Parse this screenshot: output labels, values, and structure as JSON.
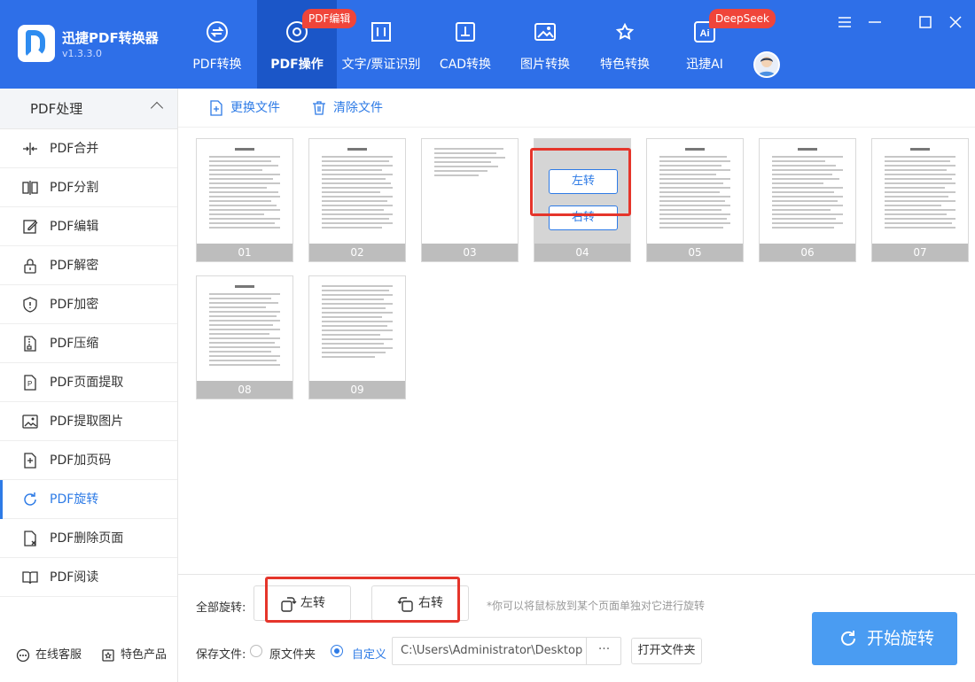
{
  "app": {
    "name": "迅捷PDF转换器",
    "version": "v1.3.3.0"
  },
  "nav": {
    "tabs": [
      {
        "label": "PDF转换",
        "icon": "pdf-convert-icon"
      },
      {
        "label": "PDF操作",
        "icon": "pdf-operate-icon",
        "active": true,
        "badge": "PDF编辑"
      },
      {
        "label": "文字/票证识别",
        "icon": "ocr-icon"
      },
      {
        "label": "CAD转换",
        "icon": "cad-icon"
      },
      {
        "label": "图片转换",
        "icon": "image-icon"
      },
      {
        "label": "特色转换",
        "icon": "star-convert-icon"
      },
      {
        "label": "迅捷AI",
        "icon": "ai-icon",
        "badge": "DeepSeek"
      }
    ]
  },
  "sidebar": {
    "section": "PDF处理",
    "items": [
      {
        "label": "PDF合并",
        "icon": "merge-icon"
      },
      {
        "label": "PDF分割",
        "icon": "split-icon"
      },
      {
        "label": "PDF编辑",
        "icon": "edit-icon"
      },
      {
        "label": "PDF解密",
        "icon": "unlock-icon"
      },
      {
        "label": "PDF加密",
        "icon": "shield-icon"
      },
      {
        "label": "PDF压缩",
        "icon": "compress-icon"
      },
      {
        "label": "PDF页面提取",
        "icon": "extract-page-icon"
      },
      {
        "label": "PDF提取图片",
        "icon": "extract-image-icon"
      },
      {
        "label": "PDF加页码",
        "icon": "page-number-icon"
      },
      {
        "label": "PDF旋转",
        "icon": "rotate-icon",
        "active": true
      },
      {
        "label": "PDF删除页面",
        "icon": "delete-page-icon"
      },
      {
        "label": "PDF阅读",
        "icon": "book-icon"
      }
    ],
    "footer": {
      "service": "在线客服",
      "products": "特色产品"
    }
  },
  "toolbar": {
    "replace": "更换文件",
    "clear": "清除文件"
  },
  "pages": [
    "01",
    "02",
    "03",
    "04",
    "05",
    "06",
    "07",
    "08",
    "09"
  ],
  "page_hover": {
    "rotate_left": "左转",
    "rotate_right": "右转"
  },
  "bottom": {
    "rotate_all_label": "全部旋转:",
    "rotate_left": "左转",
    "rotate_right": "右转",
    "hint": "*你可以将鼠标放到某个页面单独对它进行旋转",
    "save_label": "保存文件:",
    "option_original": "原文件夹",
    "option_custom": "自定义",
    "path": "C:\\Users\\Administrator\\Desktop",
    "more": "···",
    "open_folder": "打开文件夹",
    "start": "开始旋转"
  },
  "colors": {
    "brand": "#2e6fe8",
    "accent": "#2e7be6",
    "highlight": "#e5352b",
    "badge": "#f0453a"
  }
}
